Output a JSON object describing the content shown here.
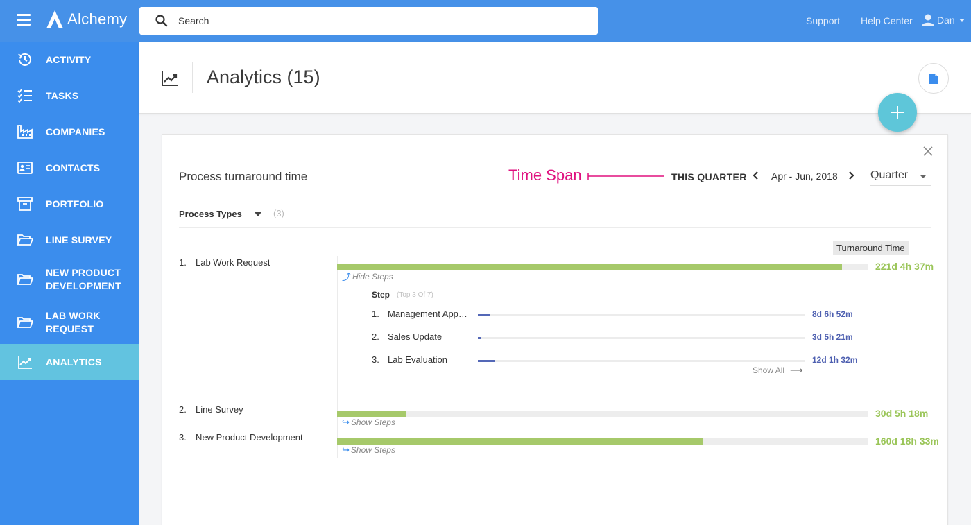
{
  "app": {
    "name": "Alchemy"
  },
  "search": {
    "placeholder": "Search"
  },
  "topnav": {
    "support": "Support",
    "help_center": "Help Center",
    "user_name": "Dan"
  },
  "sidebar": {
    "items": [
      {
        "label": "ACTIVITY",
        "icon": "history-icon"
      },
      {
        "label": "TASKS",
        "icon": "checklist-icon"
      },
      {
        "label": "COMPANIES",
        "icon": "factory-icon"
      },
      {
        "label": "CONTACTS",
        "icon": "contact-card-icon"
      },
      {
        "label": "PORTFOLIO",
        "icon": "archive-box-icon"
      },
      {
        "label": "LINE SURVEY",
        "icon": "folder-open-icon"
      },
      {
        "label": "NEW PRODUCT DEVELOPMENT",
        "icon": "folder-open-icon"
      },
      {
        "label": "LAB WORK REQUEST",
        "icon": "folder-open-icon"
      },
      {
        "label": "ANALYTICS",
        "icon": "trend-chart-icon",
        "active": true
      }
    ]
  },
  "page": {
    "title": "Analytics (15)"
  },
  "card": {
    "title": "Process turnaround time",
    "annotation": "Time Span",
    "period_label": "THIS QUARTER",
    "date_range": "Apr - Jun, 2018",
    "period_select": "Quarter",
    "filter_label": "Process Types",
    "filter_count": "(3)",
    "column_header": "Turnaround Time",
    "steps_header": "Step",
    "steps_sub": "(Top 3 Of 7)",
    "show_all": "Show All",
    "processes": [
      {
        "num": "1.",
        "name": "Lab Work Request",
        "value": "221d 4h 37m",
        "fraction": 0.951,
        "toggle": "Hide Steps"
      },
      {
        "num": "2.",
        "name": "Line Survey",
        "value": "30d 5h 18m",
        "fraction": 0.13,
        "toggle": "Show Steps"
      },
      {
        "num": "3.",
        "name": "New Product Development",
        "value": "160d 18h 33m",
        "fraction": 0.69,
        "toggle": "Show Steps"
      }
    ],
    "steps": [
      {
        "num": "1.",
        "name": "Management Approval",
        "value": "8d 6h 52m",
        "fraction": 0.036
      },
      {
        "num": "2.",
        "name": "Sales Update",
        "value": "3d 5h 21m",
        "fraction": 0.011
      },
      {
        "num": "3.",
        "name": "Lab Evaluation",
        "value": "12d 1h 32m",
        "fraction": 0.053
      }
    ]
  },
  "colors": {
    "topbar": "#4691e8",
    "sidebar": "#3b8ded",
    "active_nav": "#62c3e0",
    "bar_green": "#a6c96a",
    "step_blue": "#5468b7",
    "annotation_pink": "#e0107f",
    "fab": "#5ec6d9"
  }
}
